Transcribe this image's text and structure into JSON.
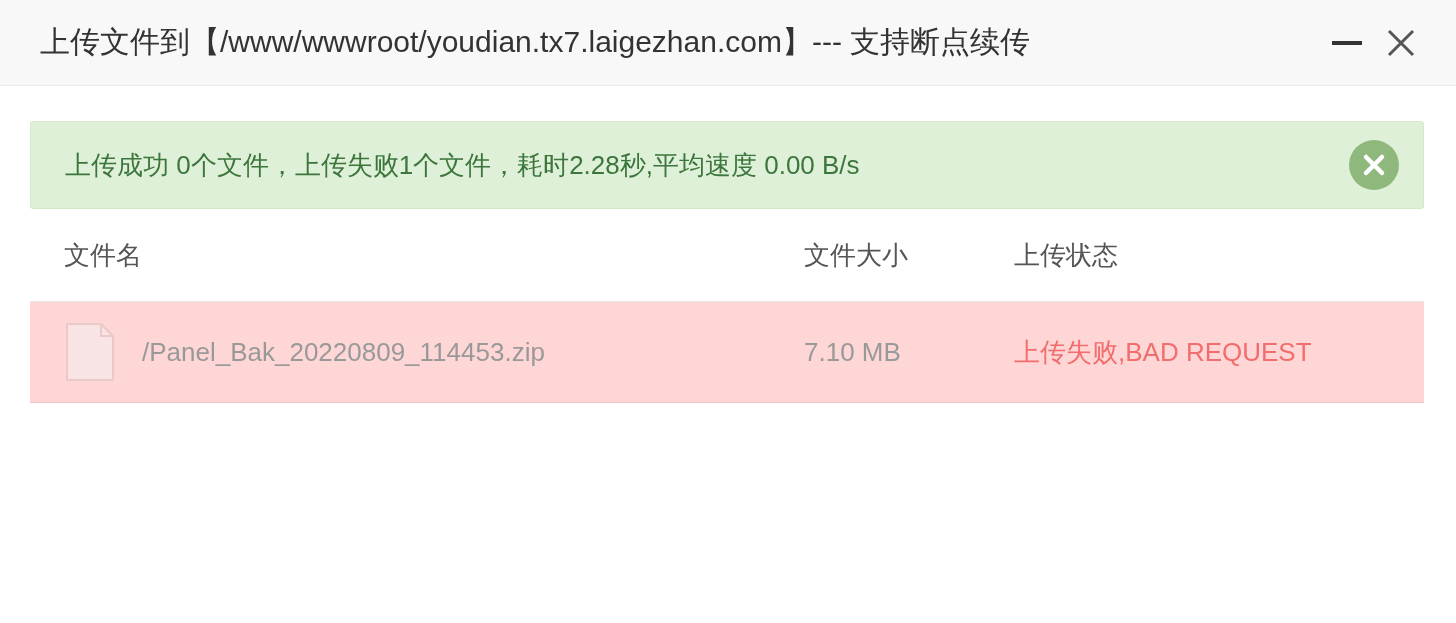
{
  "window": {
    "title": "上传文件到【/www/wwwroot/youdian.tx7.laigezhan.com】--- 支持断点续传"
  },
  "alert": {
    "kind": "success",
    "message": "上传成功 0个文件，上传失败1个文件，耗时2.28秒,平均速度 0.00 B/s"
  },
  "table": {
    "columns": [
      "文件名",
      "文件大小",
      "上传状态"
    ],
    "rows": [
      {
        "name": "/Panel_Bak_20220809_114453.zip",
        "size": "7.10 MB",
        "status": "上传失败,BAD REQUEST",
        "kind": "error"
      }
    ]
  }
}
